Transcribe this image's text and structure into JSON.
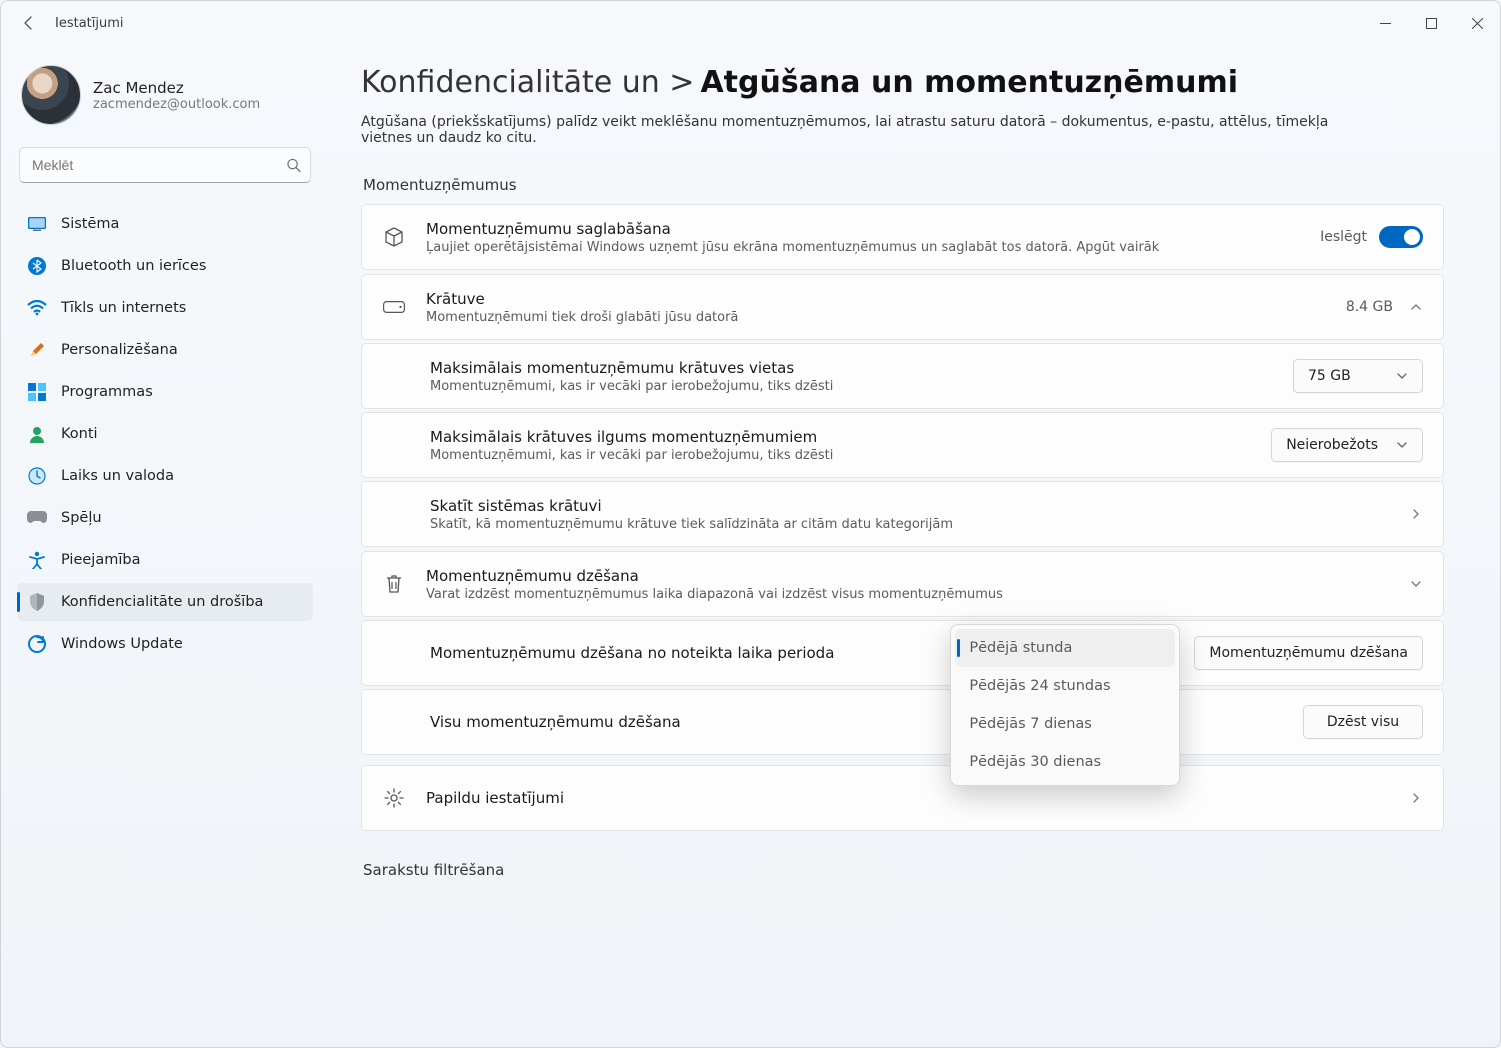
{
  "window_title": "Iestatījumi",
  "user": {
    "name": "Zac Mendez",
    "email": "zacmendez@outlook.com"
  },
  "search": {
    "placeholder": "Meklēt"
  },
  "nav": {
    "items": [
      {
        "label": "Sistēma"
      },
      {
        "label": "Bluetooth un ierīces"
      },
      {
        "label": "Tīkls un internets"
      },
      {
        "label": "Personalizēšana"
      },
      {
        "label": "Programmas"
      },
      {
        "label": "Konti"
      },
      {
        "label": "Laiks un valoda"
      },
      {
        "label": "Spēļu"
      },
      {
        "label": "Pieejamība"
      },
      {
        "label": "Konfidencialitāte un drošība"
      },
      {
        "label": "Windows Update"
      }
    ]
  },
  "breadcrumb": {
    "category": "Konfidencialitāte un >",
    "page": "Atgūšana un momentuzņēmumi"
  },
  "page_description": "Atgūšana (priekšskatījums) palīdz veikt meklēšanu momentuzņēmumos, lai atrastu saturu datorā – dokumentus, e-pastu, attēlus, tīmekļa vietnes un daudz ko citu.",
  "section_snapshots_label": "Momentuzņēmumus",
  "save_snapshots": {
    "title": "Momentuzņēmumu saglabāšana",
    "sub": "Ļaujiet operētājsistēmai Windows uzņemt jūsu ekrāna momentuzņēmumus un saglabāt tos datorā. Apgūt vairāk",
    "state_label": "Ieslēgt"
  },
  "storage": {
    "title": "Krātuve",
    "sub": "Momentuzņēmumi tiek droši glabāti jūsu datorā",
    "used": "8.4 GB"
  },
  "max_space": {
    "title": "Maksimālais momentuzņēmumu krātuves vietas",
    "sub": "Momentuzņēmumi, kas ir vecāki par ierobežojumu, tiks dzēsti",
    "value": "75 GB"
  },
  "max_duration": {
    "title": "Maksimālais krātuves ilgums momentuzņēmumiem",
    "sub": "Momentuzņēmumi, kas ir vecāki par ierobežojumu, tiks dzēsti",
    "value": "Neierobežots"
  },
  "view_storage": {
    "title": "Skatīt sistēmas krātuvi",
    "sub": "Skatīt, kā momentuzņēmumu krātuve tiek salīdzināta ar citām datu kategorijām"
  },
  "delete_snapshots": {
    "title": "Momentuzņēmumu dzēšana",
    "sub": "Varat izdzēst momentuzņēmumus laika diapazonā vai izdzēst visus momentuzņēmumus"
  },
  "delete_range": {
    "title": "Momentuzņēmumu dzēšana no noteikta laika perioda",
    "button": "Momentuzņēmumu dzēšana",
    "options": [
      "Pēdējā stunda",
      "Pēdējās 24 stundas",
      "Pēdējās 7 dienas",
      "Pēdējās 30 dienas"
    ]
  },
  "delete_all": {
    "title": "Visu momentuzņēmumu dzēšana",
    "button": "Dzēst visu"
  },
  "advanced": {
    "title": "Papildu iestatījumi"
  },
  "filter_heading": "Sarakstu filtrēšana"
}
